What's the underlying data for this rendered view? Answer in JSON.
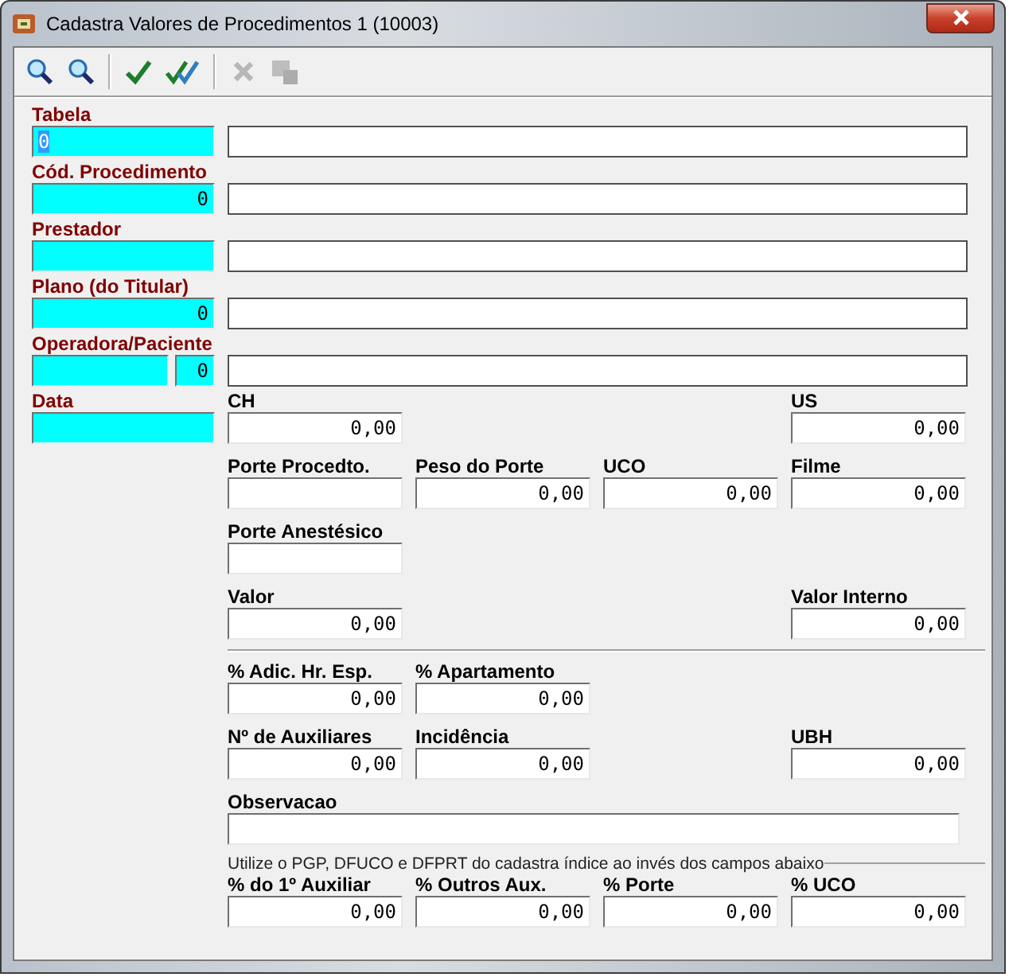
{
  "window": {
    "title": "Cadastra Valores de Procedimentos 1 (10003)"
  },
  "toolbar": [
    {
      "kind": "search",
      "disabled": false
    },
    {
      "kind": "search",
      "disabled": false
    },
    {
      "kind": "separator"
    },
    {
      "kind": "check",
      "disabled": false
    },
    {
      "kind": "double-check",
      "disabled": false
    },
    {
      "kind": "separator"
    },
    {
      "kind": "cancel",
      "disabled": true
    },
    {
      "kind": "window",
      "disabled": true
    }
  ],
  "lookups": [
    {
      "label": "Tabela",
      "codes": [
        {
          "kind": "code",
          "value": "0",
          "value_selected": true
        }
      ]
    },
    {
      "label": "Cód. Procedimento",
      "codes": [
        {
          "kind": "code",
          "value": "0",
          "value_selected": false
        }
      ]
    },
    {
      "label": "Prestador",
      "codes": [
        {
          "kind": "code"
        }
      ]
    },
    {
      "label": "Plano (do Titular)",
      "codes": [
        {
          "kind": "code",
          "value": "0",
          "value_selected": false
        }
      ]
    },
    {
      "label": "Operadora/Paciente",
      "codes": [
        {
          "kind": "code"
        },
        {
          "kind": "code",
          "value": "0",
          "value_selected": false
        }
      ]
    }
  ],
  "date": {
    "label": "Data"
  },
  "groups": [
    {
      "rows": [
        [
          {
            "label": "CH",
            "value": "0,00"
          },
          null,
          null,
          {
            "label": "US",
            "value": "0,00"
          }
        ],
        [
          {
            "label": "Porte Procedto."
          },
          {
            "label": "Peso do Porte",
            "value": "0,00"
          },
          {
            "label": "UCO",
            "value": "0,00"
          },
          {
            "label": "Filme",
            "value": "0,00"
          }
        ],
        [
          {
            "label": "Porte Anestésico"
          },
          null,
          null,
          null
        ],
        [
          {
            "label": "Valor",
            "value": "0,00"
          },
          null,
          null,
          {
            "label": "Valor Interno",
            "value": "0,00"
          }
        ]
      ]
    },
    {
      "rows": [
        [
          {
            "label": "% Adic. Hr. Esp.",
            "value": "0,00"
          },
          {
            "label": "% Apartamento",
            "value": "0,00"
          },
          null,
          null
        ],
        [
          {
            "label": "Nº de Auxiliares",
            "value": "0,00"
          },
          {
            "label": "Incidência",
            "value": "0,00"
          },
          null,
          {
            "label": "UBH",
            "value": "0,00"
          }
        ],
        [
          {
            "label": "Observacao",
            "kind": "wide"
          }
        ]
      ]
    },
    {
      "caption": "Utilize o PGP, DFUCO e DFPRT do cadastra índice ao invés dos campos abaixo",
      "rows": [
        [
          {
            "label": "% do 1º Auxiliar",
            "value": "0,00"
          },
          {
            "label": "% Outros Aux.",
            "value": "0,00"
          },
          {
            "label": "% Porte",
            "value": "0,00"
          },
          {
            "label": "% UCO",
            "value": "0,00"
          }
        ]
      ]
    }
  ]
}
